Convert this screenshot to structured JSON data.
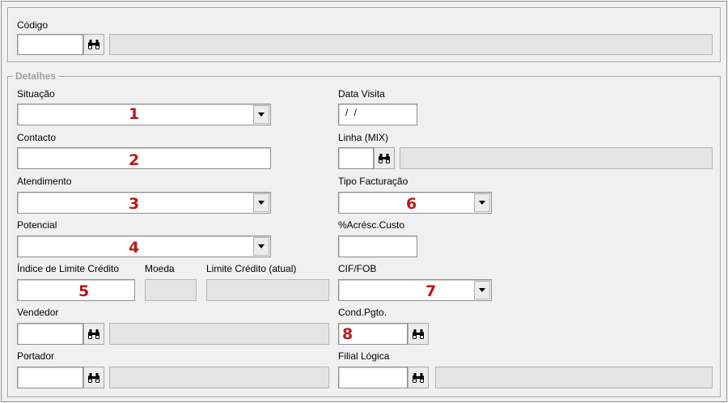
{
  "codigo": {
    "label": "Código",
    "value": "",
    "description": ""
  },
  "detalhes": {
    "legend": "Detalhes",
    "situacao": {
      "label": "Situação",
      "value": "",
      "marker": "1"
    },
    "contacto": {
      "label": "Contacto",
      "value": "",
      "marker": "2"
    },
    "atendimento": {
      "label": "Atendimento",
      "value": "",
      "marker": "3"
    },
    "potencial": {
      "label": "Potencial",
      "value": "",
      "marker": "4"
    },
    "indice_limite": {
      "label": "Índice de Limite Crédito",
      "value": "",
      "marker": "5"
    },
    "moeda": {
      "label": "Moeda",
      "value": ""
    },
    "limite_credito": {
      "label": "Limite Crédito (atual)",
      "value": ""
    },
    "vendedor": {
      "label": "Vendedor",
      "value": "",
      "description": ""
    },
    "portador": {
      "label": "Portador",
      "value": "",
      "description": ""
    },
    "data_visita": {
      "label": "Data Visita",
      "value": "/ /"
    },
    "linha_mix": {
      "label": "Linha (MIX)",
      "value": "",
      "description": ""
    },
    "tipo_facturacao": {
      "label": "Tipo Facturação",
      "value": "",
      "marker": "6"
    },
    "acresc_custo": {
      "label": "%Acrésc.Custo",
      "value": ""
    },
    "cif_fob": {
      "label": "CIF/FOB",
      "value": "",
      "marker": "7"
    },
    "cond_pgto": {
      "label": "Cond.Pgto.",
      "value": "",
      "marker": "8"
    },
    "filial_logica": {
      "label": "Filial Lógica",
      "value": "",
      "description": ""
    }
  },
  "icons": {
    "lookup": "binoculars-icon",
    "dropdown": "chevron-down-icon"
  },
  "colors": {
    "marker": "#b81a1a",
    "panel": "#f0f0f0",
    "readonly": "#e4e4e4"
  }
}
